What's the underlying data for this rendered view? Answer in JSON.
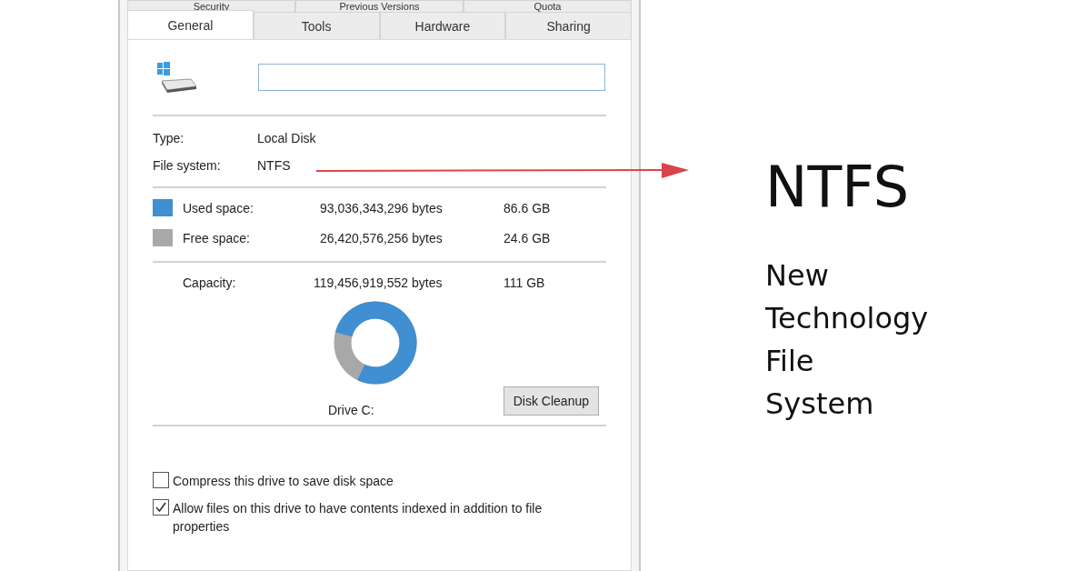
{
  "dialog": {
    "tab_rows": [
      [
        {
          "label": "Security",
          "selected": false
        },
        {
          "label": "Previous Versions",
          "selected": false
        },
        {
          "label": "Quota",
          "selected": false
        }
      ],
      [
        {
          "label": "General",
          "selected": true
        },
        {
          "label": "Tools",
          "selected": false
        },
        {
          "label": "Hardware",
          "selected": false
        },
        {
          "label": "Sharing",
          "selected": false
        }
      ]
    ],
    "details": [
      {
        "label": "Type:",
        "value": "Local Disk"
      },
      {
        "label": "File system:",
        "value": "NTFS"
      }
    ],
    "space": [
      {
        "label": "Used space:",
        "bytes": "93,036,343,296 bytes",
        "size": "86.6 GB",
        "color": "#3f8fd2"
      },
      {
        "label": "Free space:",
        "bytes": "26,420,576,256 bytes",
        "size": "24.6 GB",
        "color": "#a8a8a8"
      }
    ],
    "capacity": {
      "label": "Capacity:",
      "bytes": "119,456,919,552 bytes",
      "size": "111 GB"
    },
    "usage": {
      "level": 0.779
    },
    "drive_label": "Drive C:",
    "cleanup_button": "Disk Cleanup",
    "options": [
      {
        "label": "Compress this drive to save disk space",
        "checked": false
      },
      {
        "label": "Allow files on this drive to have contents indexed in addition to file properties",
        "checked": true
      }
    ]
  },
  "annotation": {
    "title": "NTFS",
    "lines": [
      "New",
      "Technology",
      "File",
      "System"
    ]
  }
}
